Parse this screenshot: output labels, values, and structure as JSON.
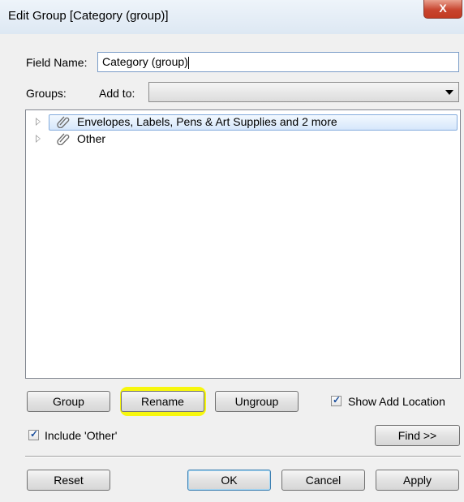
{
  "window": {
    "title": "Edit Group [Category (group)]",
    "close_label": "X"
  },
  "field_name": {
    "label": "Field Name:",
    "value": "Category (group)"
  },
  "groups": {
    "label": "Groups:",
    "add_to_label": "Add to:",
    "add_to_value": ""
  },
  "tree": {
    "items": [
      {
        "label": "Envelopes, Labels, Pens & Art Supplies and 2 more",
        "selected": true,
        "icon": "paperclip-icon"
      },
      {
        "label": "Other",
        "selected": false,
        "icon": "paperclip-icon"
      }
    ]
  },
  "actions": {
    "group_label": "Group",
    "rename_label": "Rename",
    "ungroup_label": "Ungroup",
    "show_add_location_label": "Show Add Location",
    "show_add_location_checked": true,
    "include_other_label": "Include 'Other'",
    "include_other_checked": true,
    "find_label": "Find >>"
  },
  "footer": {
    "reset_label": "Reset",
    "ok_label": "OK",
    "cancel_label": "Cancel",
    "apply_label": "Apply"
  },
  "colors": {
    "highlight": "#f7f700",
    "selection": "#d6e7fb",
    "close": "#c8452f"
  }
}
